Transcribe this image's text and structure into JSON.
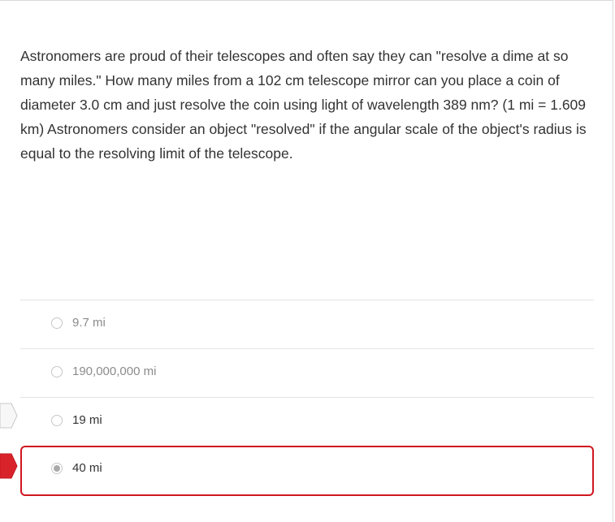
{
  "question": {
    "text": "Astronomers are proud of their telescopes and often say they can \"resolve a dime at so many miles.\" How many miles from a 102 cm telescope mirror can you place a coin of diameter 3.0 cm and just resolve the coin using light of wavelength 389 nm?  (1 mi = 1.609 km) Astronomers consider an object \"resolved\" if the angular scale of the object's radius is equal to the resolving limit of the telescope."
  },
  "answers": [
    {
      "label": "9.7 mi"
    },
    {
      "label": "190,000,000 mi"
    },
    {
      "label": "19 mi"
    },
    {
      "label": "40 mi"
    }
  ],
  "selection": {
    "selected_index": 3,
    "highlight_color": "#d0171f",
    "marker_color": "#d9232a"
  }
}
